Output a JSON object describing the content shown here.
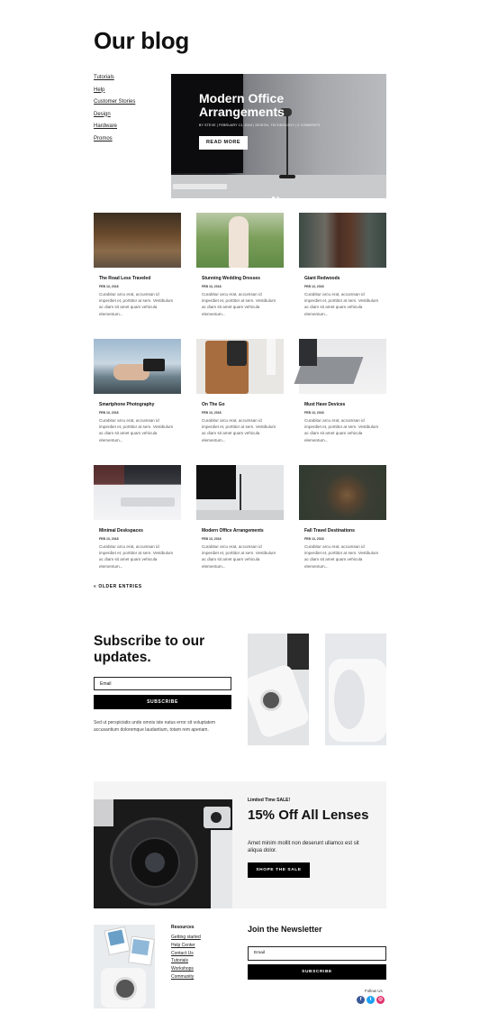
{
  "page": {
    "title": "Our blog"
  },
  "categories": [
    "Tutorials",
    "Help",
    "Customer Stories",
    "Design",
    "Hardware",
    "Promos"
  ],
  "hero": {
    "title": "Modern Office Arrangements",
    "meta": "BY STEVE | FEBRUARY 13, 2018 | DESIGN, TECHNOLOGY | 0 COMMENTS",
    "button": "READ MORE"
  },
  "posts": [
    {
      "title": "The Road Less Traveled",
      "date": "FEB 13, 2018",
      "excerpt": "Curabitur arcu erat, accumsan id imperdiet et, porttitor at sem. Vestibulum ac diam sit amet quam vehicula elementum..."
    },
    {
      "title": "Stunning Wedding Dresses",
      "date": "FEB 13, 2018",
      "excerpt": "Curabitur arcu erat, accumsan id imperdiet et, porttitor at sem. Vestibulum ac diam sit amet quam vehicula elementum..."
    },
    {
      "title": "Giant Redwoods",
      "date": "FEB 13, 2018",
      "excerpt": "Curabitur arcu erat, accumsan id imperdiet et, porttitor at sem. Vestibulum ac diam sit amet quam vehicula elementum..."
    },
    {
      "title": "Smartphone Photography",
      "date": "FEB 13, 2018",
      "excerpt": "Curabitur arcu erat, accumsan id imperdiet et, porttitor at sem. Vestibulum ac diam sit amet quam vehicula elementum..."
    },
    {
      "title": "On The Go",
      "date": "FEB 13, 2018",
      "excerpt": "Curabitur arcu erat, accumsan id imperdiet et, porttitor at sem. Vestibulum ac diam sit amet quam vehicula elementum..."
    },
    {
      "title": "Must Have Devices",
      "date": "FEB 13, 2018",
      "excerpt": "Curabitur arcu erat, accumsan id imperdiet et, porttitor at sem. Vestibulum ac diam sit amet quam vehicula elementum..."
    },
    {
      "title": "Minimal Deskspaces",
      "date": "FEB 13, 2018",
      "excerpt": "Curabitur arcu erat, accumsan id imperdiet et, porttitor at sem. Vestibulum ac diam sit amet quam vehicula elementum..."
    },
    {
      "title": "Modern Office Arrangements",
      "date": "FEB 13, 2018",
      "excerpt": "Curabitur arcu erat, accumsan id imperdiet et, porttitor at sem. Vestibulum ac diam sit amet quam vehicula elementum..."
    },
    {
      "title": "Fall Travel Destinations",
      "date": "FEB 13, 2018",
      "excerpt": "Curabitur arcu erat, accumsan id imperdiet et, porttitor at sem. Vestibulum ac diam sit amet quam vehicula elementum..."
    }
  ],
  "older_entries": "« OLDER ENTRIES",
  "subscribe": {
    "title": "Subscribe to our updates.",
    "email_placeholder": "Email",
    "button": "SUBSCRIBE",
    "note": "Sed ut perspiciatis unde omnis iste natus error sit voluptatem accusantium doloremque laudantium, totam rem aperiam."
  },
  "promo": {
    "small": "Limited Time SALE!",
    "title": "15% Off All Lenses",
    "text": "Amet minim mollit non deserunt ullamco est sit aliqua dolor.",
    "button": "SHOPE THE SALE"
  },
  "footer": {
    "resources_title": "Resources",
    "resources": [
      "Getting started",
      "Help Center",
      "Contact Us",
      "Tutorials",
      "Workshops",
      "Community"
    ],
    "newsletter_title": "Join the Newsletter",
    "email_placeholder": "Email",
    "button": "SUBSCRIBE",
    "follow": "Follow Us",
    "social": [
      {
        "icon": "facebook-icon",
        "glyph": "f",
        "color": "#3b5998"
      },
      {
        "icon": "twitter-icon",
        "glyph": "t",
        "color": "#1da1f2"
      },
      {
        "icon": "instagram-icon",
        "glyph": "◎",
        "color": "#e1306c"
      }
    ]
  }
}
